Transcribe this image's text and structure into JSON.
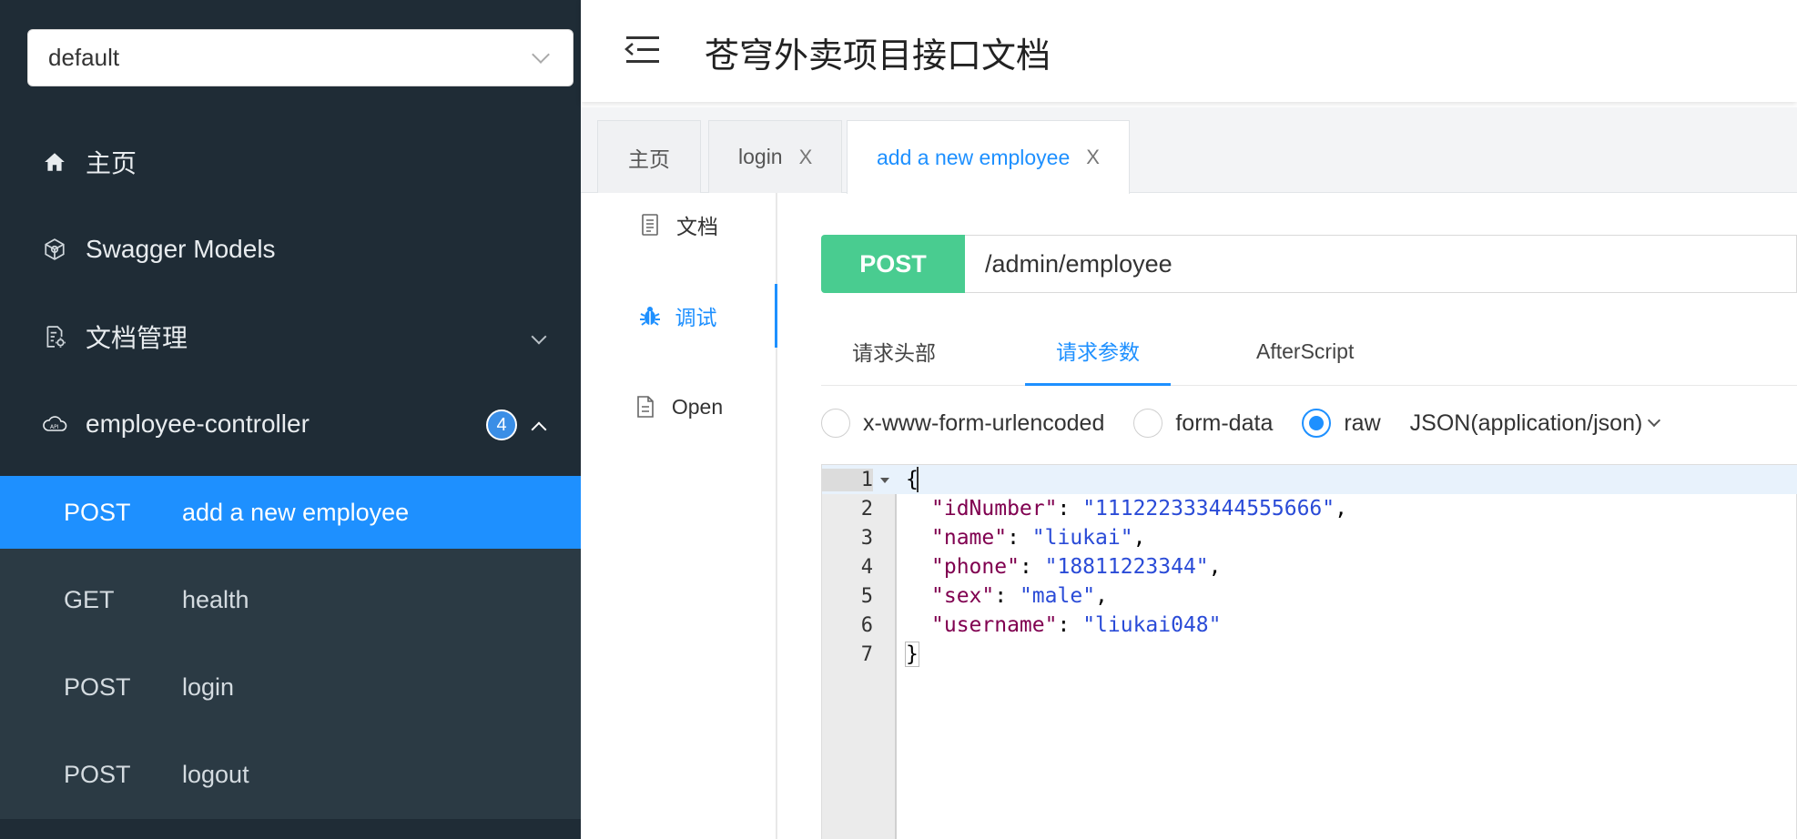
{
  "sidebar": {
    "group_select": "default",
    "menu": [
      {
        "label": "主页",
        "icon": "home-icon"
      },
      {
        "label": "Swagger Models",
        "icon": "cube-icon"
      },
      {
        "label": "文档管理",
        "icon": "doc-settings-icon"
      },
      {
        "label": "employee-controller",
        "icon": "cloud-api-icon",
        "badge": "4"
      }
    ],
    "endpoints": [
      {
        "method": "POST",
        "label": "add a new employee",
        "active": true
      },
      {
        "method": "GET",
        "label": "health"
      },
      {
        "method": "POST",
        "label": "login"
      },
      {
        "method": "POST",
        "label": "logout"
      }
    ]
  },
  "header": {
    "title": "苍穹外卖项目接口文档"
  },
  "tabs": [
    {
      "label": "主页"
    },
    {
      "label": "login",
      "close": "X"
    },
    {
      "label": "add a new employee",
      "close": "X",
      "active": true
    }
  ],
  "inner_nav": [
    {
      "label": "文档",
      "icon": "document-icon"
    },
    {
      "label": "调试",
      "icon": "bug-icon",
      "active": true
    },
    {
      "label": "Open",
      "icon": "file-icon"
    }
  ],
  "request": {
    "method": "POST",
    "url": "/admin/employee"
  },
  "subtabs": [
    {
      "label": "请求头部"
    },
    {
      "label": "请求参数",
      "active": true
    },
    {
      "label": "AfterScript"
    }
  ],
  "body_types": [
    {
      "label": "x-www-form-urlencoded",
      "checked": false
    },
    {
      "label": "form-data",
      "checked": false
    },
    {
      "label": "raw",
      "checked": true
    }
  ],
  "content_type": "JSON(application/json)",
  "editor": {
    "lines": [
      "1",
      "2",
      "3",
      "4",
      "5",
      "6",
      "7"
    ],
    "open_brace": "{",
    "close_brace": "}",
    "fields": [
      {
        "key": "\"idNumber\"",
        "value": "\"111222333444555666\"",
        "comma": ","
      },
      {
        "key": "\"name\"",
        "value": "\"liukai\"",
        "comma": ","
      },
      {
        "key": "\"phone\"",
        "value": "\"18811223344\"",
        "comma": ","
      },
      {
        "key": "\"sex\"",
        "value": "\"male\"",
        "comma": ","
      },
      {
        "key": "\"username\"",
        "value": "\"liukai048\"",
        "comma": ""
      }
    ]
  },
  "colors": {
    "accent": "#1e90ff",
    "post": "#49cc90",
    "sidebar": "#1f2c36"
  }
}
